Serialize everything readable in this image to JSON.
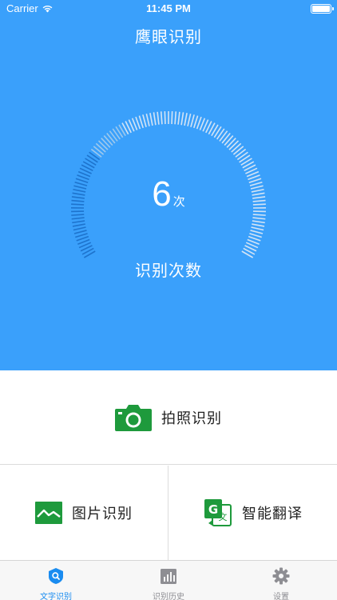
{
  "status_bar": {
    "carrier": "Carrier",
    "time": "11:45 PM",
    "wifi_icon": "wifi-icon",
    "battery_icon": "battery-icon"
  },
  "header": {
    "title": "鹰眼识别",
    "background_color": "#3aa0fb"
  },
  "gauge": {
    "count": "6",
    "unit": "次",
    "caption": "识别次数"
  },
  "actions": {
    "camera": {
      "label": "拍照识别",
      "icon": "camera-icon"
    },
    "picture": {
      "label": "图片识别",
      "icon": "image-icon"
    },
    "translate": {
      "label": "智能翻译",
      "icon": "translate-icon"
    },
    "icon_color": "#1e9a3c"
  },
  "tabbar": {
    "tabs": [
      {
        "label": "文字识别",
        "icon": "text-recognition-icon",
        "active": true
      },
      {
        "label": "识别历史",
        "icon": "history-chart-icon",
        "active": false
      },
      {
        "label": "设置",
        "icon": "gear-icon",
        "active": false
      }
    ],
    "active_color": "#1a8cf0",
    "inactive_color": "#8e8e93"
  }
}
